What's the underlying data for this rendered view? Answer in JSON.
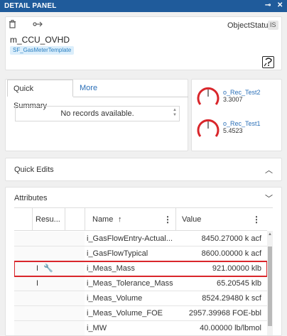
{
  "titlebar": {
    "title": "DETAIL PANEL",
    "pin_glyph": "⊸",
    "close_glyph": "✕"
  },
  "header": {
    "object_name": "m_CCU_OVHD",
    "template_badge": "SF_GasMeterTemplate",
    "status_label": "ObjectStatus",
    "status_value": "IS",
    "icons": [
      "trash-icon",
      "link-icon",
      "help-icon"
    ]
  },
  "summary": {
    "tabs": [
      {
        "label": "Quick Summary",
        "active": true
      },
      {
        "label": "More",
        "active": false
      }
    ],
    "empty_text": "No records available."
  },
  "gauges": [
    {
      "name": "o_Rec_Test2",
      "value": "3.3007",
      "color": "#d9262b"
    },
    {
      "name": "o_Rec_Test1",
      "value": "5.4523",
      "color": "#d9262b"
    }
  ],
  "quick_edits": {
    "title": "Quick Edits"
  },
  "attributes": {
    "title": "Attributes",
    "columns": {
      "result": "Resu...",
      "name": "Name",
      "name_sort": "↑",
      "value": "Value"
    },
    "rows": [
      {
        "result": "",
        "icon": "",
        "name": "i_GasFlowEntry-Actual...",
        "value": "8450.27000 k acf"
      },
      {
        "result": "",
        "icon": "",
        "name": "i_GasFlowTypical",
        "value": "8600.00000 k acf"
      },
      {
        "result": "I",
        "icon": "🔧",
        "name": "i_Meas_Mass",
        "value": "921.00000 klb"
      },
      {
        "result": "I",
        "icon": "",
        "name": "i_Meas_Tolerance_Mass",
        "value": "65.20545 klb"
      },
      {
        "result": "",
        "icon": "",
        "name": "i_Meas_Volume",
        "value": "8524.29480 k scf"
      },
      {
        "result": "",
        "icon": "",
        "name": "i_Meas_Volume_FOE",
        "value": "2957.39968 FOE-bbl"
      },
      {
        "result": "",
        "icon": "",
        "name": "i_MW",
        "value": "40.00000 lb/lbmol"
      }
    ]
  },
  "colors": {
    "titlebar": "#1f5b9b",
    "accent": "#2a6fb8",
    "highlight": "#d9262b"
  }
}
